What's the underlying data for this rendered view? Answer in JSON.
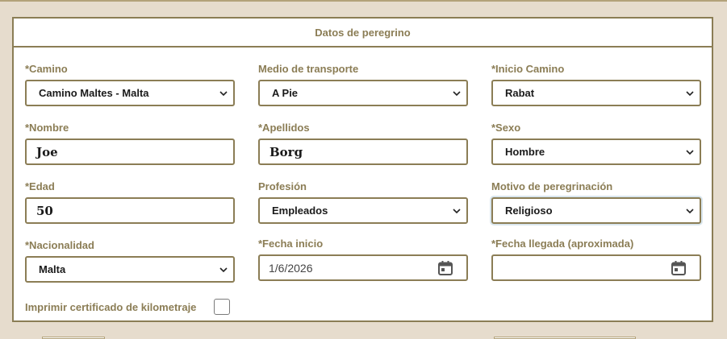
{
  "form": {
    "header": "Datos de peregrino",
    "camino": {
      "label": "*Camino",
      "value": "Camino Maltes - Malta"
    },
    "transporte": {
      "label": "Medio de transporte",
      "value": "A Pie"
    },
    "inicio": {
      "label": "*Inicio Camino",
      "value": "Rabat"
    },
    "nombre": {
      "label": "*Nombre",
      "value": "Joe"
    },
    "apellidos": {
      "label": "*Apellidos",
      "value": "Borg"
    },
    "sexo": {
      "label": "*Sexo",
      "value": "Hombre"
    },
    "edad": {
      "label": "*Edad",
      "value": "50"
    },
    "profesion": {
      "label": "Profesión",
      "value": "Empleados"
    },
    "motivo": {
      "label": "Motivo de peregrinación",
      "value": "Religioso"
    },
    "nacionalidad": {
      "label": "*Nacionalidad",
      "value": "Malta"
    },
    "fecha_inicio": {
      "label": "*Fecha inicio",
      "value": "1/6/2026"
    },
    "fecha_llegada": {
      "label": "*Fecha llegada (aproximada)",
      "value": ""
    },
    "certificado": {
      "label": "Imprimir certificado de kilometraje",
      "checked": false
    }
  },
  "icons": {
    "select_arrow": "chevron-down-icon",
    "date_picker": "calendar-icon"
  },
  "colors": {
    "accent": "#8b7d55",
    "background": "#e6dccd",
    "panel": "#ffffff"
  }
}
